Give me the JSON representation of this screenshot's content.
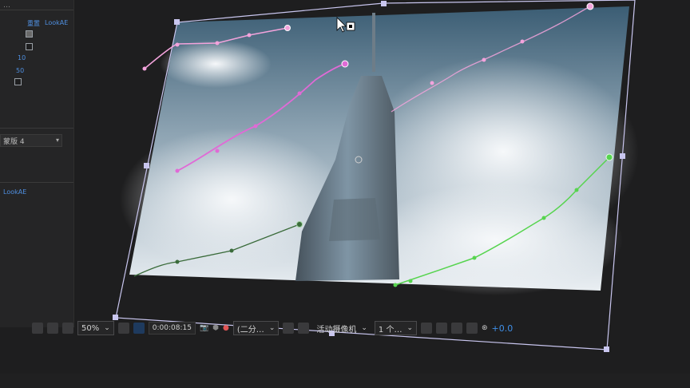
{
  "left_panel": {
    "top_text": "…",
    "row1_label": "重置",
    "row1_value": "LookAE",
    "values": [
      "10",
      "50"
    ],
    "dropdown_label": "蒙版 4",
    "bottom_value": "LookAE"
  },
  "toolbar": {
    "zoom": "50%",
    "timecode": "0:00:08:15",
    "resolution": "(二分…",
    "camera": "活动摄像机",
    "views": "1 个…",
    "exposure": "+0.0"
  },
  "colors": {
    "accent_blue": "#3f8fe8",
    "pink_path": "#f3a3dc",
    "magenta_path": "#e06ad6",
    "green_path": "#56d44e",
    "dark_green_path": "#3a6b3a",
    "layer_bbox": "#c9c6ef"
  }
}
